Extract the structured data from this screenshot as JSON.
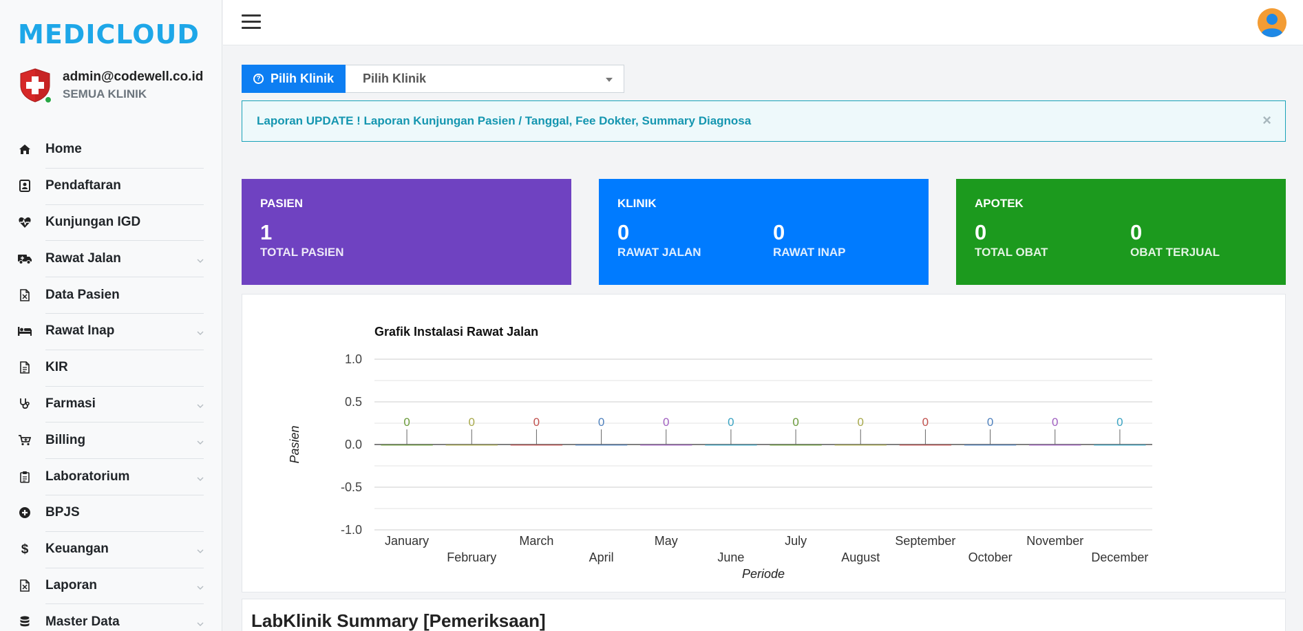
{
  "app": {
    "logo_text": "MEDICLOUD"
  },
  "user": {
    "email": "admin@codewell.co.id",
    "role": "SEMUA KLINIK"
  },
  "sidebar": {
    "items": [
      {
        "label": "Home",
        "icon": "home-icon",
        "expandable": false
      },
      {
        "label": "Pendaftaran",
        "icon": "id-card-icon",
        "expandable": false
      },
      {
        "label": "Kunjungan IGD",
        "icon": "heartbeat-icon",
        "expandable": false
      },
      {
        "label": "Rawat Jalan",
        "icon": "ambulance-icon",
        "expandable": true
      },
      {
        "label": "Data Pasien",
        "icon": "file-excel-icon",
        "expandable": false
      },
      {
        "label": "Rawat Inap",
        "icon": "bed-icon",
        "expandable": true
      },
      {
        "label": "KIR",
        "icon": "file-icon",
        "expandable": false
      },
      {
        "label": "Farmasi",
        "icon": "stethoscope-icon",
        "expandable": true
      },
      {
        "label": "Billing",
        "icon": "cart-icon",
        "expandable": true
      },
      {
        "label": "Laboratorium",
        "icon": "clipboard-icon",
        "expandable": true
      },
      {
        "label": "BPJS",
        "icon": "plus-circle-icon",
        "expandable": false
      },
      {
        "label": "Keuangan",
        "icon": "dollar-icon",
        "expandable": true
      },
      {
        "label": "Laporan",
        "icon": "file-excel-icon",
        "expandable": true
      },
      {
        "label": "Master Data",
        "icon": "database-icon",
        "expandable": true
      }
    ]
  },
  "clinic_select": {
    "button_label": "Pilih Klinik",
    "selected": "Pilih Klinik"
  },
  "alert": {
    "text": "Laporan UPDATE ! Laporan Kunjungan Pasien / Tanggal, Fee Dokter, Summary Diagnosa",
    "close": "×"
  },
  "cards": {
    "pasien": {
      "title": "PASIEN",
      "stats": [
        {
          "value": "1",
          "label": "TOTAL PASIEN"
        }
      ],
      "color": "#6f42c1"
    },
    "klinik": {
      "title": "KLINIK",
      "stats": [
        {
          "value": "0",
          "label": "RAWAT JALAN"
        },
        {
          "value": "0",
          "label": "RAWAT INAP"
        }
      ],
      "color": "#007bff"
    },
    "apotek": {
      "title": "APOTEK",
      "stats": [
        {
          "value": "0",
          "label": "TOTAL OBAT"
        },
        {
          "value": "0",
          "label": "OBAT TERJUAL"
        }
      ],
      "color": "#1c9a1e"
    }
  },
  "chart_data": {
    "type": "bar",
    "title": "Grafik Instalasi Rawat Jalan",
    "xlabel": "Periode",
    "ylabel": "Pasien",
    "ylim": [
      -1.0,
      1.0
    ],
    "yticks": [
      "1.0",
      "0.5",
      "0.0",
      "-0.5",
      "-1.0"
    ],
    "ytick_values": [
      1.0,
      0.5,
      0.0,
      -0.5,
      -1.0
    ],
    "categories": [
      "January",
      "February",
      "March",
      "April",
      "May",
      "June",
      "July",
      "August",
      "September",
      "October",
      "November",
      "December"
    ],
    "values": [
      0,
      0,
      0,
      0,
      0,
      0,
      0,
      0,
      0,
      0,
      0,
      0
    ],
    "data_labels": [
      "0",
      "0",
      "0",
      "0",
      "0",
      "0",
      "0",
      "0",
      "0",
      "0",
      "0",
      "0"
    ],
    "label_colors": [
      "#6a9a3a",
      "#a7a84a",
      "#c0504d",
      "#4f81bd",
      "#a05fc0",
      "#3aa3c2",
      "#6a9a3a",
      "#a7a84a",
      "#c0504d",
      "#4f81bd",
      "#a05fc0",
      "#3aa3c2"
    ],
    "grid": true,
    "legend": "none"
  },
  "lab_summary": {
    "title": "LabKlinik Summary [Pemeriksaan]"
  }
}
